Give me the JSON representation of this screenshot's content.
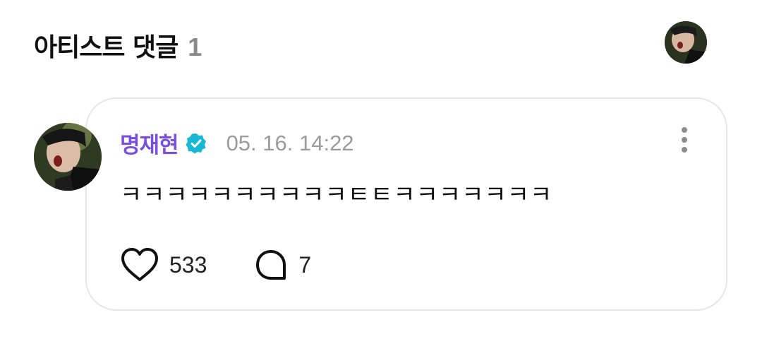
{
  "header": {
    "title": "아티스트 댓글",
    "count": "1"
  },
  "comment": {
    "author": "명재현",
    "timestamp": "05. 16. 14:22",
    "text": "ㅋㅋㅋㅋㅋㅋㅋㅋㅋㅋㅌㅌㅋㅋㅋㅋㅋㅋㅋ",
    "likes": "533",
    "replies": "7"
  },
  "icons": {
    "verified": "verified-badge-icon",
    "more": "more-vertical-icon",
    "like": "heart-outline-icon",
    "reply": "speech-bubble-icon"
  },
  "colors": {
    "author_name": "#7a4fe0",
    "verified_badge": "#16b8d6",
    "timestamp": "#9b9b9b",
    "count": "#8a8a8a"
  }
}
